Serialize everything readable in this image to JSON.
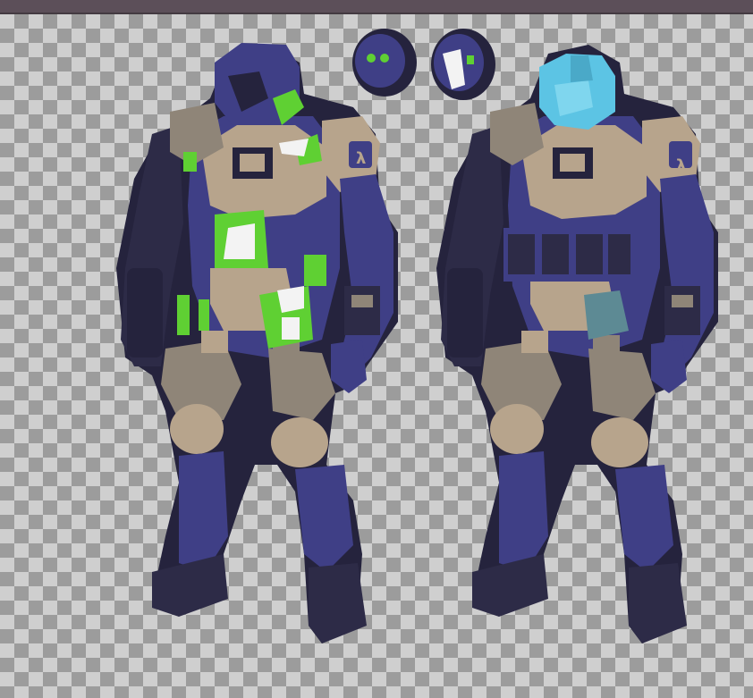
{
  "image": {
    "description_colors": {
      "ink": "#25233d",
      "armor_blue": "#3f3f86",
      "armor_tan": "#b7a48c",
      "highlight_green": "#5fd033",
      "highlight_white": "#f3f3f3",
      "visor_cyan": "#5cc4e4",
      "accent_teal": "#5d8a94"
    },
    "figures": [
      {
        "name": "soldier-left",
        "variant": "green-glow"
      },
      {
        "name": "soldier-right",
        "variant": "cyan-helmet"
      }
    ],
    "emblem_glyph": "λ"
  }
}
